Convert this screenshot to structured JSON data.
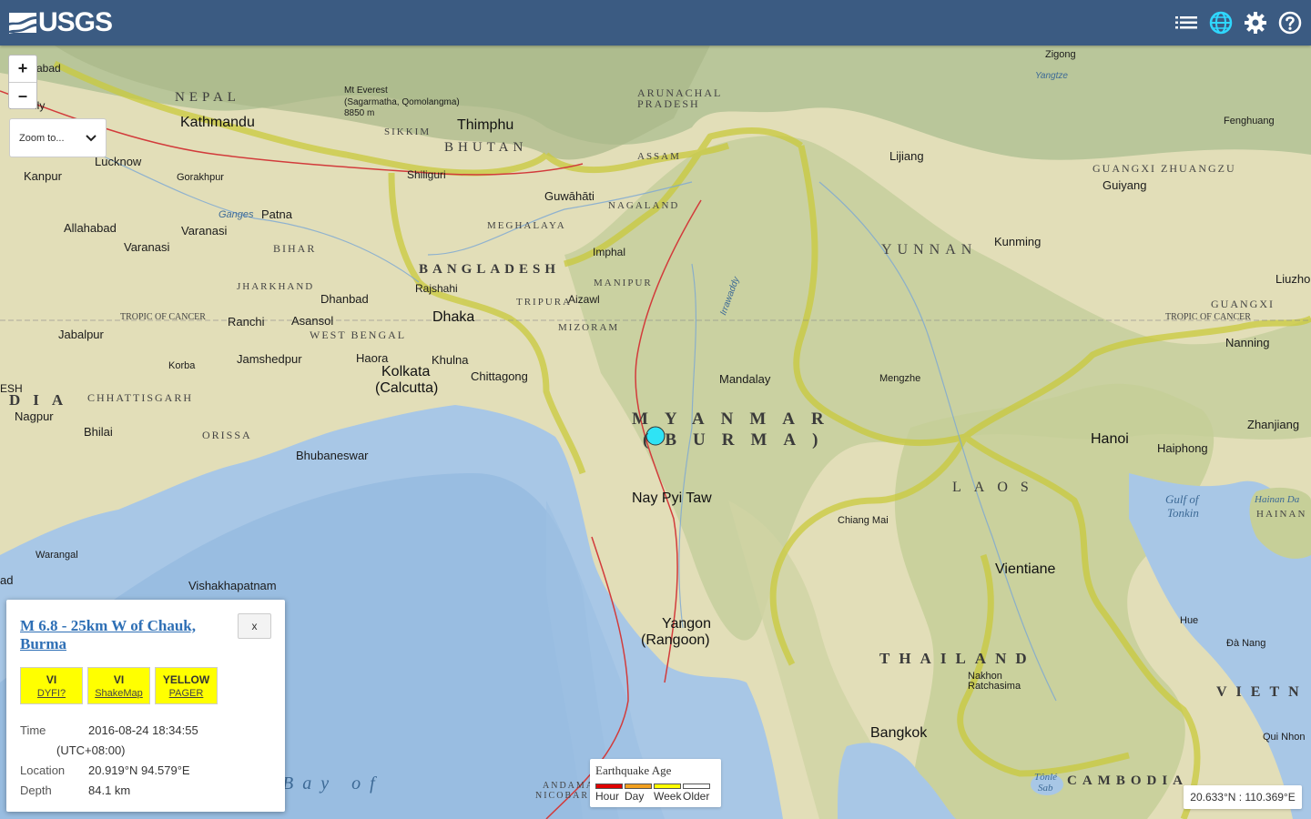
{
  "header": {
    "logo_text": "USGS",
    "icons": [
      "list-icon",
      "globe-icon",
      "gear-icon",
      "help-icon"
    ]
  },
  "map_controls": {
    "zoom_in": "+",
    "zoom_out": "–",
    "zoom_to_label": "Zoom to..."
  },
  "map_labels": {
    "countries": [
      "NEPAL",
      "BHUTAN",
      "BANGLADESH",
      "MYANMAR",
      "(BURMA)",
      "LAOS",
      "THAILAND",
      "CAMBODIA",
      "VIETN",
      "DIA"
    ],
    "regions": [
      "ARUNACHAL",
      "PRADESH",
      "SIKKIM",
      "ASSAM",
      "NAGALAND",
      "MEGHALAYA",
      "MANIPUR",
      "TRIPURA",
      "MIZORAM",
      "BIHAR",
      "JHARKHAND",
      "WEST BENGAL",
      "CHHATTISGARH",
      "ORISSA",
      "YUNNAN",
      "GUANGXI ZHUANGZU",
      "GUANGXI",
      "HAINAN",
      "TROPIC OF CANCER",
      "TROPIC OF CANCER"
    ],
    "cities": [
      "Kathmandu",
      "Thimphu",
      "Lucknow",
      "Kanpur",
      "Gorakhpur",
      "Shiliguri",
      "Guwāhāti",
      "Patna",
      "Allahabad",
      "Varanasi",
      "Varanasi",
      "Dhanbad",
      "Ranchi",
      "Asansol",
      "Jabalpur",
      "Jamshedpur",
      "Haora",
      "Kolkata",
      "(Calcutta)",
      "Khulna",
      "Chittagong",
      "Dhaka",
      "Rajshahi",
      "Imphal",
      "Aizawl",
      "Mandalay",
      "Nay Pyi Taw",
      "Yangon",
      "(Rangoon)",
      "Mengzhe",
      "Lijiang",
      "Kunming",
      "Guiyang",
      "Zigong",
      "Fenghuang",
      "Nanning",
      "Liuzho",
      "Zhanjiang",
      "Hanoi",
      "Haiphong",
      "Vientiane",
      "Chiang Mai",
      "Bangkok",
      "Nakhon",
      "Ratchasima",
      "Hue",
      "Đà Nang",
      "Qui Nhon",
      "Nagpur",
      "Bhilai",
      "Korba",
      "Bhubaneswar",
      "Warangal",
      "Vishakhapatnam",
      "Mt Everest",
      "(Sagarmatha, Qomolangma)",
      "8850 m",
      "Bareilly",
      "Ganges",
      "Irrawaddy",
      "Yangtze",
      "ESH",
      "ad",
      "abad"
    ],
    "water": [
      "Gulf of",
      "Tonkin",
      "Bay of",
      "Tônlé",
      "Sab",
      "ANDAMAN",
      "NICOBAR",
      "Hainan Da"
    ]
  },
  "popup": {
    "title": "M 6.8 - 25km W of Chauk, Burma",
    "close_label": "x",
    "badges": [
      {
        "value": "VI",
        "source": "DYFI?",
        "color": "#ffff00"
      },
      {
        "value": "VI",
        "source": "ShakeMap",
        "color": "#ffff00"
      },
      {
        "value": "YELLOW",
        "source": "PAGER",
        "color": "#ffff00"
      }
    ],
    "details": [
      {
        "key": "Time",
        "value": "2016-08-24 18:34:55"
      },
      {
        "key": "",
        "value": "(UTC+08:00)"
      },
      {
        "key": "Location",
        "value": "20.919°N 94.579°E"
      },
      {
        "key": "Depth",
        "value": "84.1 km"
      }
    ]
  },
  "legend": {
    "title": "Earthquake Age",
    "items": [
      {
        "label": "Hour",
        "color": "#e00000"
      },
      {
        "label": "Day",
        "color": "#f2a020"
      },
      {
        "label": "Week",
        "color": "#ffff00"
      },
      {
        "label": "Older",
        "color": "#ffffff"
      }
    ]
  },
  "coords_readout": "20.633°N : 110.369°E",
  "colors": {
    "header_bg": "#3b5b82",
    "land": "#e2deb8",
    "water": "#a8c7e6",
    "epicenter": "#2fe3f5",
    "border": "#c8c640",
    "fault": "#d23b3b"
  }
}
